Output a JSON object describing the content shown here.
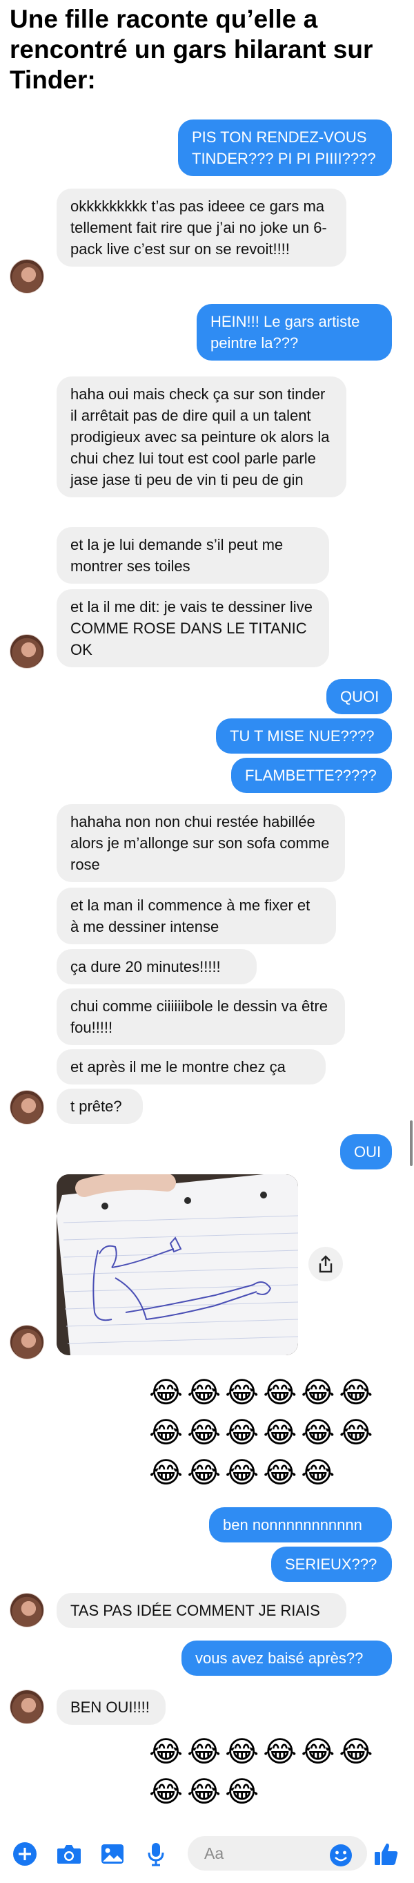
{
  "title": "Une fille raconte qu’elle a rencontré un gars hilarant sur Tinder:",
  "messages": {
    "m1": "PIS TON RENDEZ-VOUS TINDER??? PI PI PIIII????",
    "m2": "okkkkkkkkk t’as pas ideee ce gars ma tellement fait rire que j’ai no joke un 6-pack live c’est sur on se revoit!!!!",
    "m3": "HEIN!!! Le gars artiste peintre la???",
    "m4": "haha oui mais check ça sur son tinder il arrêtait pas de dire quil a un talent prodigieux avec sa peinture ok alors la chui chez lui tout est cool parle parle jase jase ti peu de vin ti peu de gin",
    "m5": "et la je lui demande s’il peut me montrer ses toiles",
    "m6": "et la il me dit: je vais te dessiner live COMME ROSE DANS LE TITANIC OK",
    "m7": "QUOI",
    "m8": "TU T MISE NUE????",
    "m9": "FLAMBETTE?????",
    "m10": "hahaha non non chui restée habillée alors je m’allonge sur son sofa comme rose",
    "m11": "et la man il commence à me fixer et à me dessiner intense",
    "m12": "ça dure 20 minutes!!!!!",
    "m13": "chui comme ciiiiiibole le dessin va être fou!!!!!",
    "m14": "et après il me le montre chez ça",
    "m15": "t prête?",
    "m16": "OUI",
    "m17": "ben nonnnnnnnnnnn",
    "m18": "SERIEUX???",
    "m19": "TAS PAS IDÉE COMMENT JE RIAIS",
    "m20": "vous avez baisé après??",
    "m21": "BEN OUI!!!!"
  },
  "emojis": {
    "row1": "😂😂😂😂😂😂",
    "row2": "😂😂😂😂😂😂",
    "row3": "😂😂😂😂😂",
    "row4": "😂😂😂😂😂😂",
    "row5": "😂😂😂"
  },
  "composer": {
    "placeholder": "Aa"
  },
  "colors": {
    "outgoing": "#2f8cf3",
    "incoming": "#efefef",
    "accent": "#1877f2"
  },
  "icons": [
    "plus-icon",
    "camera-icon",
    "gallery-icon",
    "microphone-icon",
    "emoji-icon",
    "like-icon",
    "share-icon"
  ]
}
